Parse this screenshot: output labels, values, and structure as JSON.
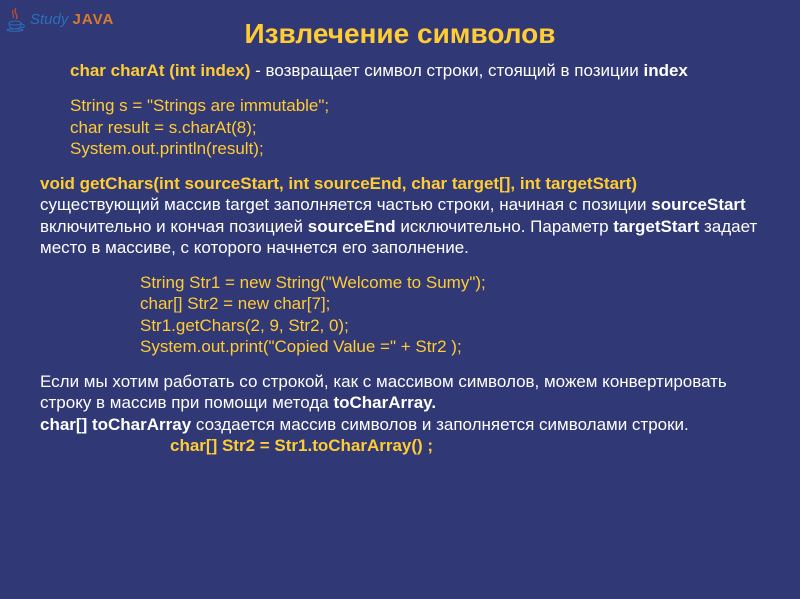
{
  "logo": {
    "study": "Study",
    "java": "JAVA"
  },
  "title": "Извлечение символов",
  "p1": {
    "sig": "char charAt (int index)",
    "desc_a": " - возвращает символ строки, стоящий в позиции ",
    "desc_b": "index"
  },
  "code1": {
    "l1": "String s = \"Strings are immutable\";",
    "l2": "char result = s.charAt(8);",
    "l3": "System.out.println(result);"
  },
  "p2": {
    "sig": "void getChars(int sourceStart, int sourceEnd, char target[], int targetStart)",
    "t1": "существующий массив target заполняется частью строки, начиная    с позиции ",
    "b1": "sourceStart",
    "t2": " включительно и кончая позицией ",
    "b2": "sourceEnd",
    "t3": " исключительно. Параметр    ",
    "b3": "targetStart",
    "t4": " задает место в массиве, с которого начнется его заполнение."
  },
  "code2": {
    "l1": "String Str1 = new String(\"Welcome to Sumy\");",
    "l2": "char[] Str2 = new char[7];",
    "l3": "Str1.getChars(2, 9, Str2, 0);",
    "l4": "System.out.print(\"Copied Value =\"  + Str2 );"
  },
  "p3": {
    "t1": "Если мы хотим работать со строкой, как с массивом символов, можем конвертировать строку в массив при помощи метода ",
    "b1": "toCharArray."
  },
  "p4": {
    "b1": "char[] toCharArray",
    "t1": " создается массив символов и заполняется символами строки."
  },
  "code3": {
    "l1": "char[] Str2 = Str1.toCharArray() ;"
  }
}
